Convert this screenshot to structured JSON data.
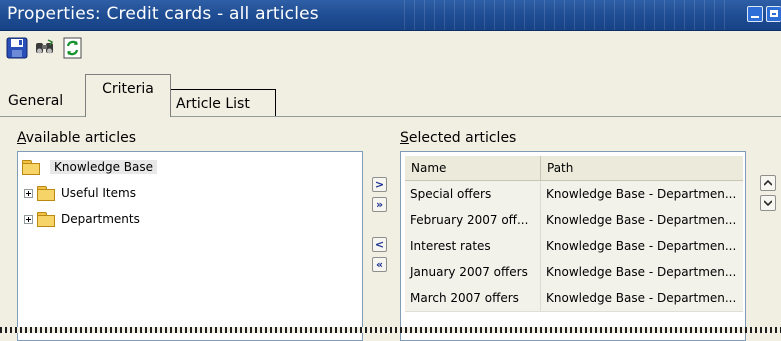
{
  "window": {
    "title": "Properties: Credit cards - all articles"
  },
  "toolbar": {
    "icons": [
      "save-icon",
      "find-icon",
      "refresh-icon"
    ]
  },
  "tabs": [
    {
      "label": "General"
    },
    {
      "label": "Criteria"
    },
    {
      "label": "Article List"
    }
  ],
  "available": {
    "label": "Available articles",
    "root": "Knowledge Base",
    "children": [
      "Useful Items",
      "Departments"
    ]
  },
  "move_buttons": [
    ">",
    "»",
    "<",
    "«"
  ],
  "selected": {
    "label": "Selected articles",
    "columns": [
      "Name",
      "Path"
    ],
    "rows": [
      {
        "name": "Special offers",
        "path": "Knowledge Base - Departmen..."
      },
      {
        "name": "February 2007 off...",
        "path": "Knowledge Base - Departmen..."
      },
      {
        "name": "Interest rates",
        "path": "Knowledge Base - Departmen..."
      },
      {
        "name": "January 2007 offers",
        "path": "Knowledge Base - Departmen..."
      },
      {
        "name": "March 2007 offers",
        "path": "Knowledge Base - Departmen..."
      }
    ]
  }
}
